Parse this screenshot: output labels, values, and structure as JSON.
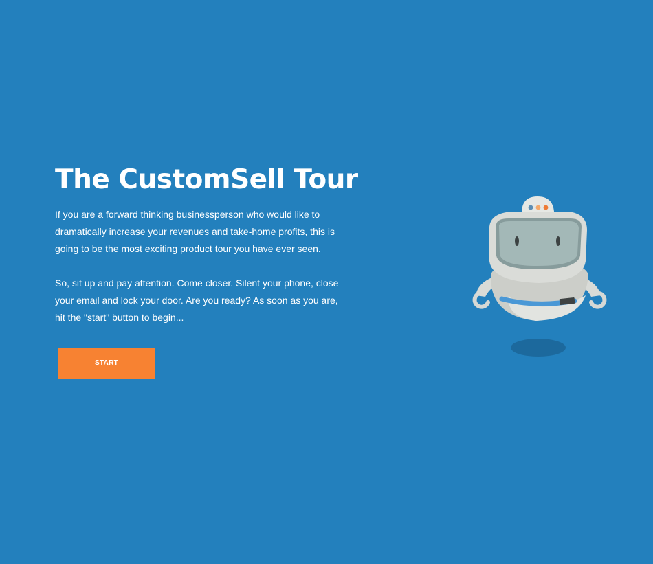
{
  "intro": {
    "title": "The CustomSell Tour",
    "paragraph_1": "If you are a forward thinking businessperson who would like to dramatically increase your revenues and take-home profits, this is going to be the most exciting product tour you have ever seen.",
    "paragraph_2": "So, sit up and pay attention. Come closer. Silent your phone, close your email and lock your door. Are you ready? As soon as you are, hit the \"start\" button to begin..."
  },
  "actions": {
    "start_label": "START"
  },
  "mascot": {
    "icon": "robot-mascot-icon"
  },
  "colors": {
    "background": "#2380BD",
    "accent": "#F78232",
    "text": "#FFFFFF"
  }
}
